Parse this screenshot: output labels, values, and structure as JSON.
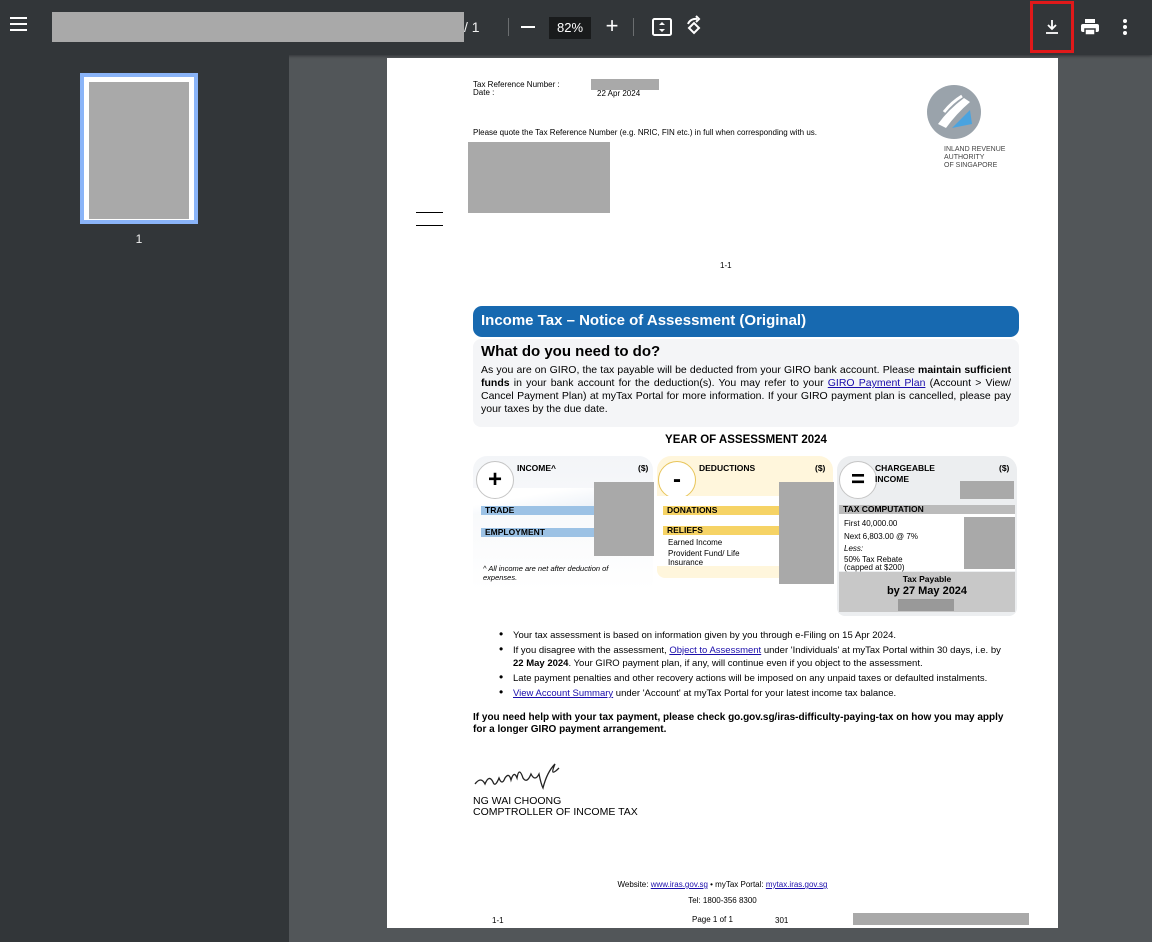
{
  "toolbar": {
    "page_total": "/  1",
    "zoom": "82%"
  },
  "sidebar": {
    "thumbnail_label": "1"
  },
  "document": {
    "tax_ref_label": "Tax Reference Number :",
    "date_label": "Date :",
    "date_value": "22 Apr 2024",
    "quote_notice": "Please quote the Tax Reference Number (e.g. NRIC, FIN etc.) in full when corresponding with us.",
    "org_name_line1": "INLAND REVENUE",
    "org_name_line2": "AUTHORITY",
    "org_name_line3": "OF SINGAPORE",
    "ref_code": "1-1",
    "banner_title": "Income Tax – Notice of Assessment (Original)",
    "todo_heading": "What do you need to do?",
    "todo_text_1": "As you are on GIRO, the tax payable will be deducted from your GIRO bank account. Please",
    "todo_bold": "maintain sufficient funds",
    "todo_text_2": "in your bank account for the deduction(s). You may refer to your",
    "todo_link": "GIRO Payment Plan",
    "todo_text_3": "(Account > View/ Cancel Payment Plan) at myTax Portal for more information. If your GIRO payment plan is cancelled, please pay your taxes by the due date.",
    "year_heading": "YEAR OF ASSESSMENT 2024",
    "income": {
      "symbol": "+",
      "title": "INCOME^",
      "unit": "($)",
      "row1": "TRADE",
      "row2": "EMPLOYMENT",
      "note": "^ All income are net after deduction of expenses."
    },
    "deductions": {
      "symbol": "-",
      "title": "DEDUCTIONS",
      "unit": "($)",
      "row1": "DONATIONS",
      "row2": "RELIEFS",
      "item1": "Earned Income",
      "item2": "Provident Fund/ Life Insurance"
    },
    "chargeable": {
      "symbol": "=",
      "title_line1": "CHARGEABLE",
      "title_line2": "INCOME",
      "unit": "($)",
      "comp_title": "TAX COMPUTATION",
      "line1": "First 40,000.00",
      "line2": "Next 6,803.00 @ 7%",
      "line3": "Less:",
      "line4": "50% Tax Rebate",
      "line5": "(capped at $200)",
      "payable_title": "Tax Payable",
      "payable_date": "by 27 May 2024"
    },
    "bullets": [
      {
        "text": "Your tax assessment is based on information given by you through e-Filing on 15 Apr 2024."
      },
      {
        "pre": "If you disagree with the assessment,",
        "link": "Object to Assessment",
        "post": "under 'Individuals' at myTax Portal within 30 days, i.e. by",
        "bold": "22 May 2024",
        "post2": ". Your GIRO payment plan, if any, will continue even if you object to the assessment."
      },
      {
        "text": "Late payment penalties and other recovery actions will be imposed on any unpaid taxes or defaulted instalments."
      },
      {
        "link": "View Account Summary",
        "post": "under 'Account' at myTax Portal for your latest income tax balance."
      }
    ],
    "help_text": "If you need help with your tax payment, please check go.gov.sg/iras-difficulty-paying-tax on how you may apply for a longer GIRO payment arrangement.",
    "signature_script": "ngwaichoong",
    "signatory_name": "NG WAI CHOONG",
    "signatory_title": "COMPTROLLER OF INCOME TAX",
    "footer_website_label": "Website:",
    "footer_website": "www.iras.gov.sg",
    "footer_portal_label": "• myTax Portal:",
    "footer_portal": "mytax.iras.gov.sg",
    "footer_tel": "Tel: 1800-356 8300",
    "footer_left": "1-1",
    "footer_page": "Page 1 of 1",
    "footer_code": "301"
  },
  "icons": {
    "menu": "hamburger-icon",
    "fit": "fit-page-icon",
    "rotate": "rotate-icon",
    "download": "download-icon",
    "print": "print-icon",
    "more": "more-vert-icon"
  },
  "colors": {
    "banner": "#1769b0",
    "toolbar": "#323639",
    "highlight": "#e0191a",
    "thumb_border": "#8ab4f8"
  }
}
